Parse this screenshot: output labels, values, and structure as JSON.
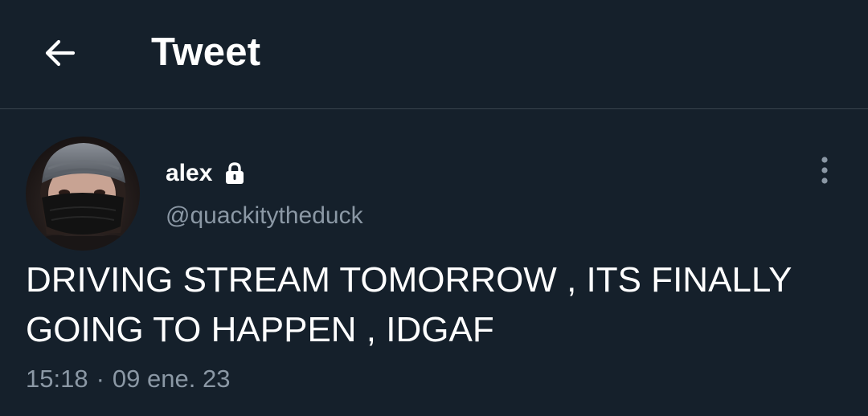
{
  "header": {
    "back_icon": "arrow-left-icon",
    "title": "Tweet"
  },
  "tweet": {
    "author": {
      "display_name": "alex",
      "protected_icon": "lock-icon",
      "handle": "@quackitytheduck",
      "avatar": "avatar-photo"
    },
    "more_icon": "more-vertical-icon",
    "text": "DRIVING STREAM TOMORROW , ITS FINALLY\nGOING TO HAPPEN , IDGAF",
    "time": "15:18",
    "separator": "·",
    "date": "09 ene. 23"
  },
  "colors": {
    "background": "#15202b",
    "text_primary": "#ffffff",
    "text_secondary": "#8b98a5",
    "divider": "#38444d"
  }
}
